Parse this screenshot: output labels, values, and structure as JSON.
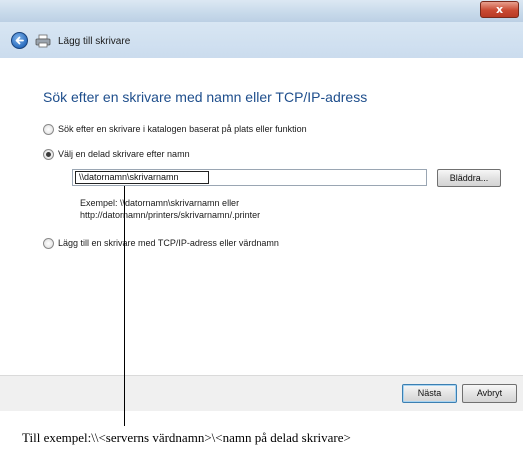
{
  "window": {
    "title": "Lägg till skrivare",
    "close_glyph": "x"
  },
  "page": {
    "heading": "Sök efter en skrivare med namn eller TCP/IP-adress"
  },
  "options": [
    {
      "label": "Sök efter en skrivare i katalogen baserat på plats eller funktion",
      "checked": false
    },
    {
      "label": "Välj en delad skrivare efter namn",
      "checked": true
    },
    {
      "label": "Lägg till en skrivare med TCP/IP-adress eller värdnamn",
      "checked": false
    }
  ],
  "shared_printer": {
    "value": "\\\\datornamn\\skrivarnamn",
    "browse_label": "Bläddra...",
    "example_line1": "Exempel: \\\\datornamn\\skrivarnamn eller",
    "example_line2": "http://datornamn/printers/skrivarnamn/.printer"
  },
  "footer": {
    "next_label": "Nästa",
    "cancel_label": "Avbryt"
  },
  "caption": "Till exempel:\\\\<serverns värdnamn>\\<namn på delad skrivare>",
  "colors": {
    "heading": "#1e4e8c",
    "close_button": "#c94a33"
  },
  "icons": [
    "back-arrow-icon",
    "printer-icon",
    "close-icon"
  ]
}
